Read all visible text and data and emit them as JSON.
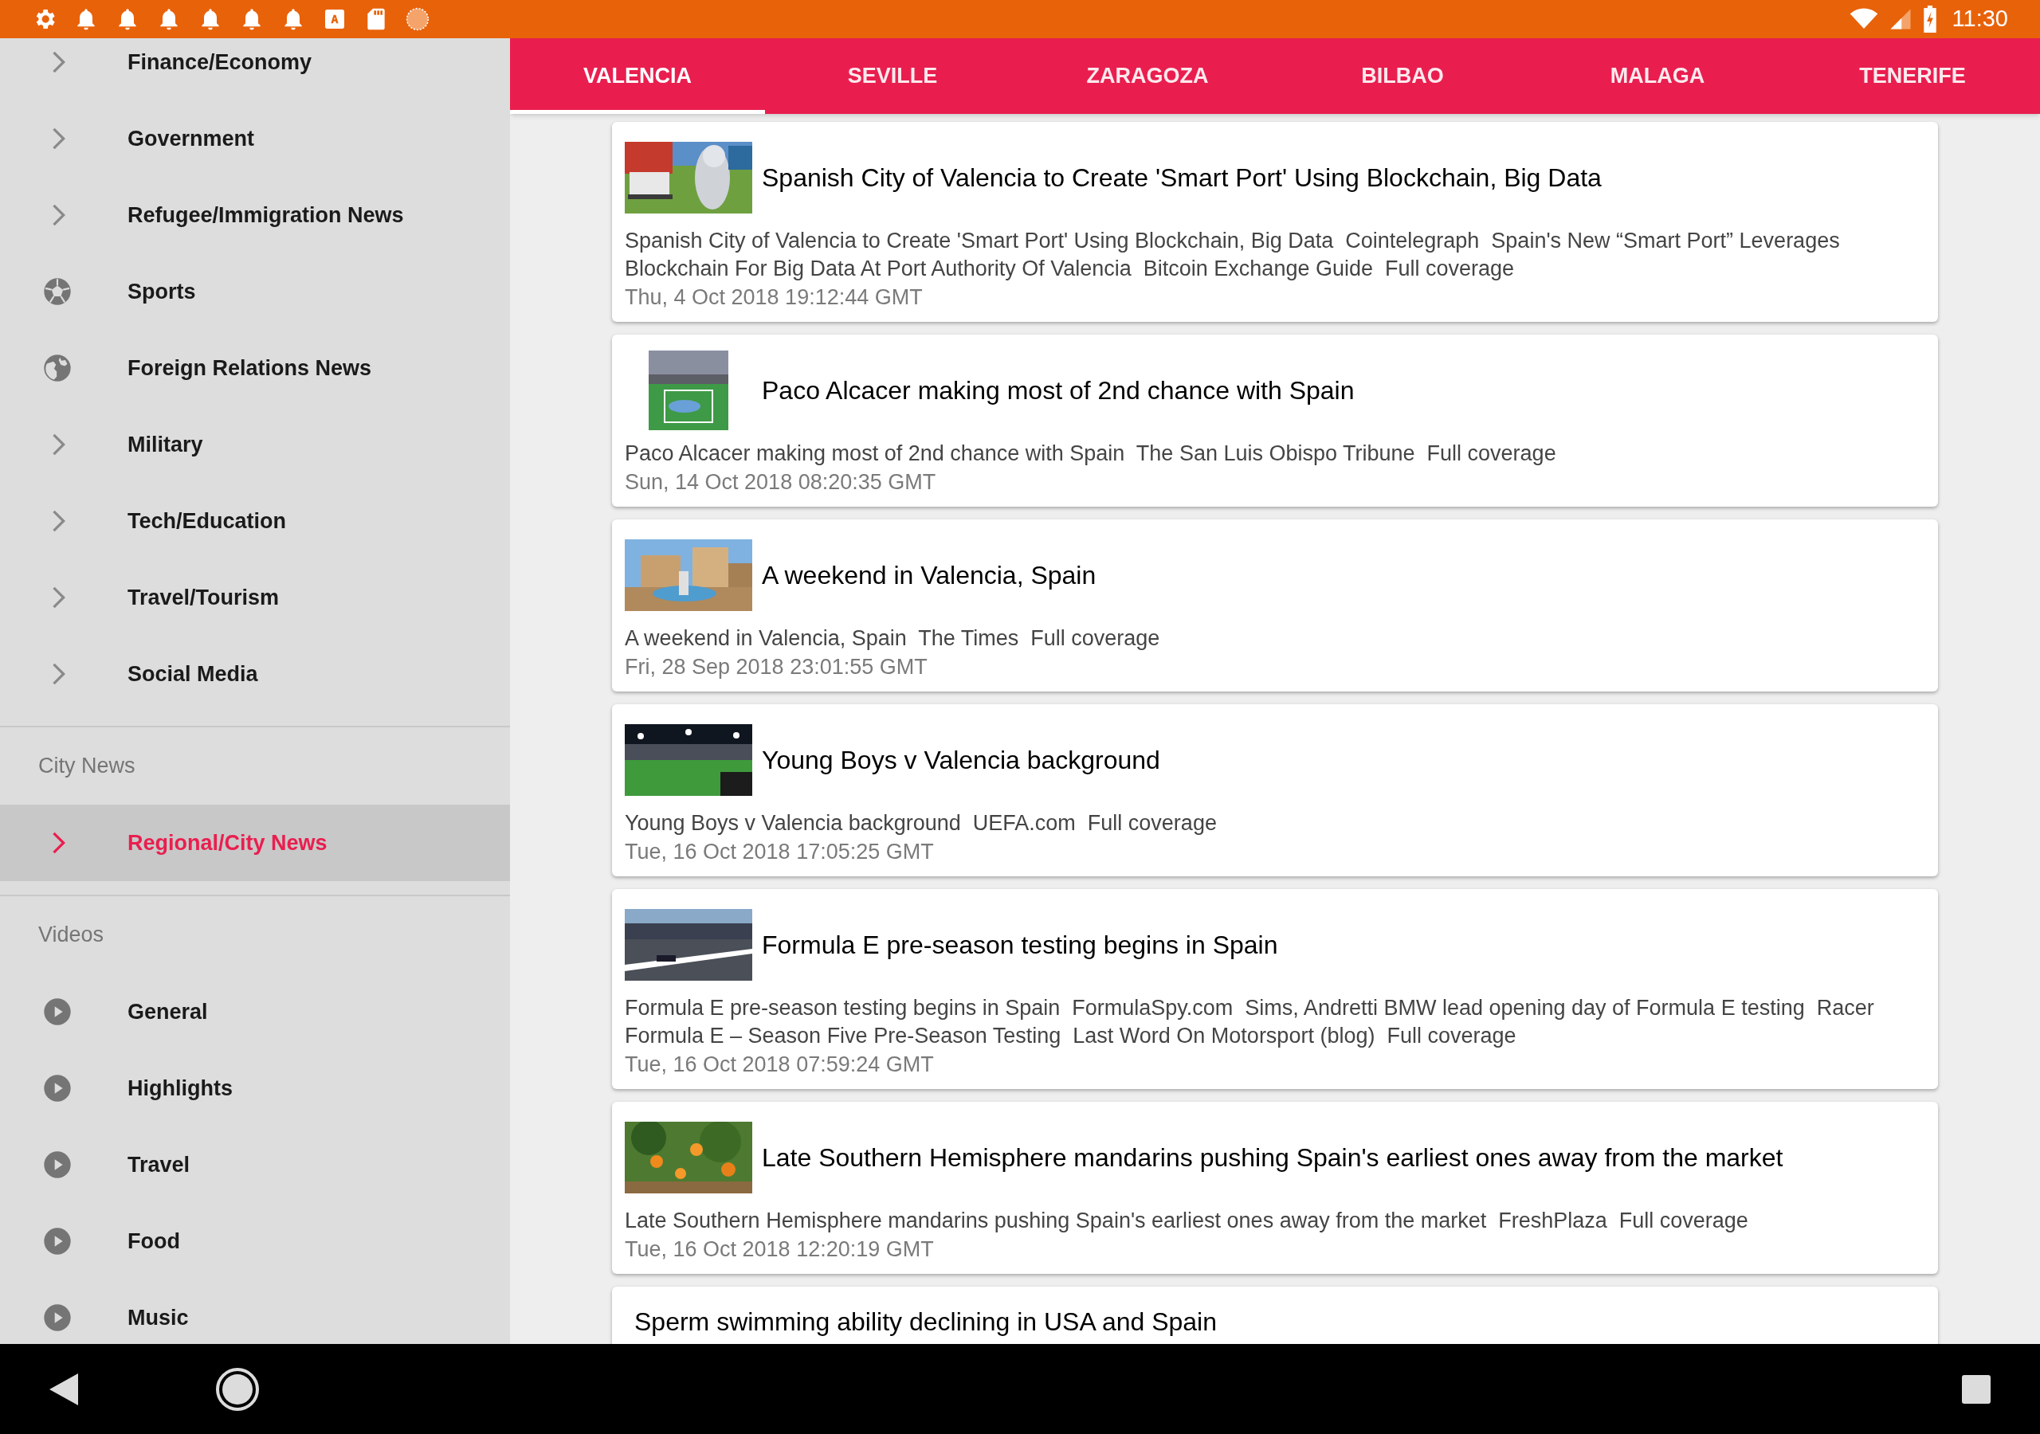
{
  "status_bar": {
    "time": "11:30"
  },
  "sidebar": {
    "sections": [
      {
        "items": [
          {
            "label": "Finance/Economy",
            "kind": "topic",
            "selected": false
          },
          {
            "label": "Government",
            "kind": "topic",
            "selected": false
          },
          {
            "label": "Refugee/Immigration News",
            "kind": "topic",
            "selected": false
          },
          {
            "label": "Sports",
            "kind": "sport",
            "selected": false
          },
          {
            "label": "Foreign Relations News",
            "kind": "world",
            "selected": false
          },
          {
            "label": "Military",
            "kind": "topic",
            "selected": false
          },
          {
            "label": "Tech/Education",
            "kind": "topic",
            "selected": false
          },
          {
            "label": "Travel/Tourism",
            "kind": "topic",
            "selected": false
          },
          {
            "label": "Social Media",
            "kind": "topic",
            "selected": false
          }
        ]
      },
      {
        "header": "City News",
        "items": [
          {
            "label": "Regional/City News",
            "kind": "topic",
            "selected": true
          }
        ]
      },
      {
        "header": "Videos",
        "items": [
          {
            "label": "General",
            "kind": "video",
            "selected": false
          },
          {
            "label": "Highlights",
            "kind": "video",
            "selected": false
          },
          {
            "label": "Travel",
            "kind": "video",
            "selected": false
          },
          {
            "label": "Food",
            "kind": "video",
            "selected": false
          },
          {
            "label": "Music",
            "kind": "video",
            "selected": false
          }
        ]
      }
    ]
  },
  "tabs": [
    {
      "label": "VALENCIA",
      "selected": true
    },
    {
      "label": "SEVILLE",
      "selected": false
    },
    {
      "label": "ZARAGOZA",
      "selected": false
    },
    {
      "label": "BILBAO",
      "selected": false
    },
    {
      "label": "MALAGA",
      "selected": false
    },
    {
      "label": "TENERIFE",
      "selected": false
    }
  ],
  "articles": [
    {
      "headline": "Spanish City of Valencia to Create 'Smart Port' Using Blockchain, Big Data",
      "summary": "Spanish City of Valencia to Create 'Smart Port' Using Blockchain, Big Data  Cointelegraph  Spain's New “Smart Port” Leverages Blockchain For Big Data At Port Authority Of Valencia  Bitcoin Exchange Guide  Full coverage",
      "date": "Thu, 4 Oct 2018 19:12:44 GMT"
    },
    {
      "headline": "Paco Alcacer making most of 2nd chance with Spain",
      "summary": "Paco Alcacer making most of 2nd chance with Spain  The San Luis Obispo Tribune  Full coverage",
      "date": "Sun, 14 Oct 2018 08:20:35 GMT"
    },
    {
      "headline": "A weekend in Valencia, Spain",
      "summary": "A weekend in Valencia, Spain  The Times  Full coverage",
      "date": "Fri, 28 Sep 2018 23:01:55 GMT"
    },
    {
      "headline": "Young Boys v Valencia background",
      "summary": "Young Boys v Valencia background  UEFA.com  Full coverage",
      "date": "Tue, 16 Oct 2018 17:05:25 GMT"
    },
    {
      "headline": "Formula E pre-season testing begins in Spain",
      "summary": "Formula E pre-season testing begins in Spain  FormulaSpy.com  Sims, Andretti BMW lead opening day of Formula E testing  Racer  Formula E – Season Five Pre-Season Testing  Last Word On Motorsport (blog)  Full coverage",
      "date": "Tue, 16 Oct 2018 07:59:24 GMT"
    },
    {
      "headline": "Late Southern Hemisphere mandarins pushing Spain's earliest ones away from the market",
      "summary": "Late Southern Hemisphere mandarins pushing Spain's earliest ones away from the market  FreshPlaza  Full coverage",
      "date": "Tue, 16 Oct 2018 12:20:19 GMT"
    },
    {
      "headline": "Sperm swimming ability declining in USA and Spain"
    }
  ]
}
